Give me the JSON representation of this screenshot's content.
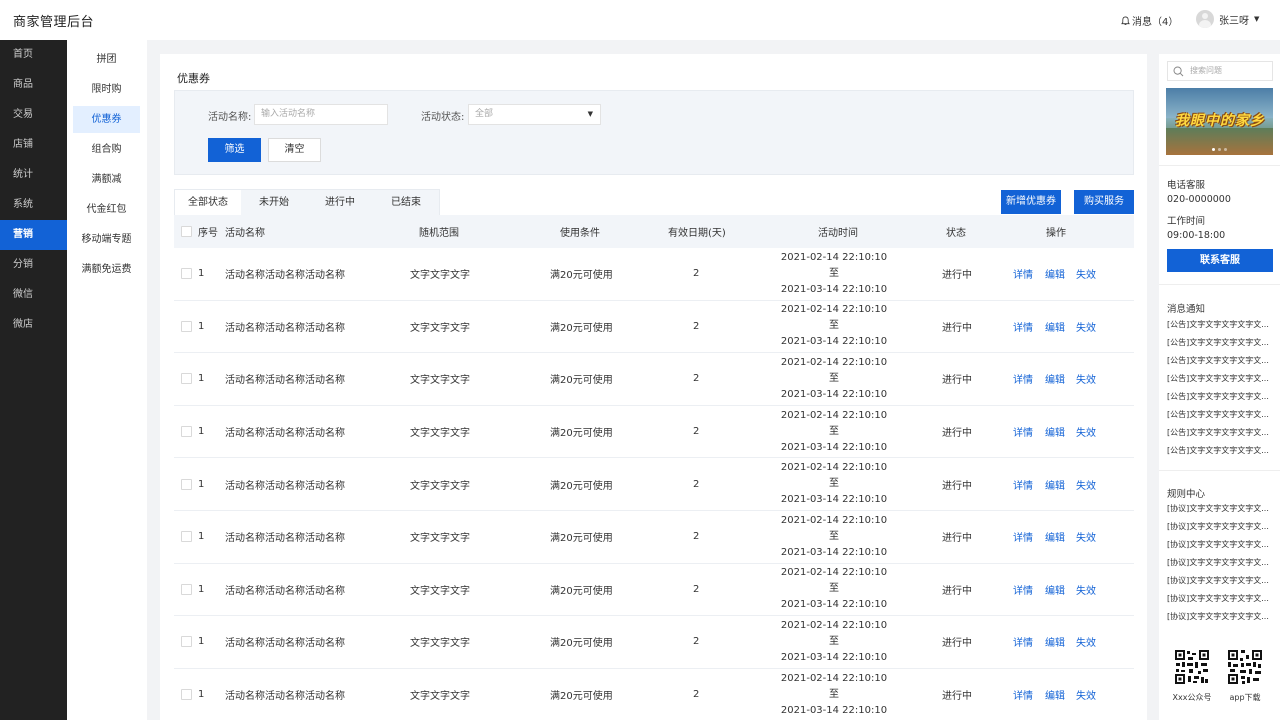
{
  "header": {
    "title": "商家管理后台",
    "messages_label": "消息（4）",
    "user_name": "张三呀"
  },
  "primary_nav": [
    "首页",
    "商品",
    "交易",
    "店铺",
    "统计",
    "系统",
    "营销",
    "分销",
    "微信",
    "微店"
  ],
  "primary_nav_active": "营销",
  "secondary_nav": [
    "拼团",
    "限时购",
    "优惠券",
    "组合购",
    "满额减",
    "代金红包",
    "移动端专题",
    "满额免运费"
  ],
  "secondary_nav_active": "优惠券",
  "page": {
    "title": "优惠券",
    "filter": {
      "name_label": "活动名称:",
      "name_placeholder": "输入活动名称",
      "status_label": "活动状态:",
      "status_value": "全部",
      "filter_button": "筛选",
      "clear_button": "清空"
    },
    "tabs": [
      "全部状态",
      "未开始",
      "进行中",
      "已结束"
    ],
    "tab_active": "全部状态",
    "actions": {
      "add_coupon": "新增优惠券",
      "buy_service": "购买服务"
    },
    "table": {
      "columns": [
        "序号",
        "活动名称",
        "随机范围",
        "使用条件",
        "有效日期(天)",
        "活动时间",
        "状态",
        "操作"
      ],
      "row": {
        "index": "1",
        "name": "活动名称活动名称活动名称",
        "scope": "文字文字文字",
        "condition": "满20元可使用",
        "days": "2",
        "time_start": "2021-02-14 22:10:10 至",
        "time_end": "2021-03-14 22:10:10",
        "status": "进行中",
        "op_detail": "详情",
        "op_edit": "编辑",
        "op_disable": "失效"
      },
      "row_count": 9
    }
  },
  "right_panel": {
    "search_placeholder": "搜索问题",
    "banner_text": "我眼中的家乡",
    "phone_label": "电话客服",
    "phone_number": "020-0000000",
    "hours_label": "工作时间",
    "hours_value": "09:00-18:00",
    "contact_button": "联系客服",
    "notice_title": "消息通知",
    "notices": [
      "[公告]文字文字文字文字文...",
      "[公告]文字文字文字文字文...",
      "[公告]文字文字文字文字文...",
      "[公告]文字文字文字文字文...",
      "[公告]文字文字文字文字文...",
      "[公告]文字文字文字文字文...",
      "[公告]文字文字文字文字文...",
      "[公告]文字文字文字文字文..."
    ],
    "rules_title": "规则中心",
    "rules": [
      "[协议]文字文字文字文字文...",
      "[协议]文字文字文字文字文...",
      "[协议]文字文字文字文字文...",
      "[协议]文字文字文字文字文...",
      "[协议]文字文字文字文字文...",
      "[协议]文字文字文字文字文...",
      "[协议]文字文字文字文字文..."
    ],
    "qr_labels": [
      "Xxx公众号",
      "app下载"
    ]
  },
  "colors": {
    "primary": "#1262d6",
    "nav_bg": "#222222",
    "banner_text": "#ffd940"
  }
}
